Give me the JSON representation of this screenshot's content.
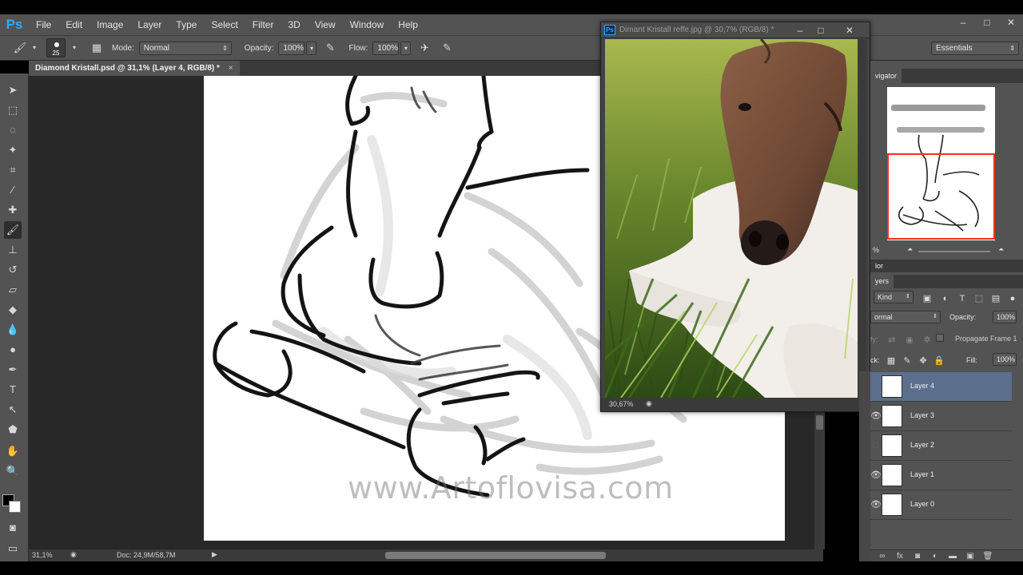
{
  "app": {
    "logo": "Ps",
    "accent": "#31a8ff"
  },
  "menu": [
    "File",
    "Edit",
    "Image",
    "Layer",
    "Type",
    "Select",
    "Filter",
    "3D",
    "View",
    "Window",
    "Help"
  ],
  "window_controls": [
    "–",
    "□",
    "✕"
  ],
  "options_bar": {
    "brush_size": "25",
    "mode_label": "Mode:",
    "mode_value": "Normal",
    "opacity_label": "Opacity:",
    "opacity_value": "100%",
    "flow_label": "Flow:",
    "flow_value": "100%",
    "workspace": "Essentials"
  },
  "document_tab": {
    "title": "Diamond Kristall.psd @ 31,1% (Layer 4, RGB/8) *",
    "close": "×"
  },
  "reference_window": {
    "title": "Dimant Kristall reffe.jpg @ 30,7% (RGB/8) *",
    "zoom": "30,67%",
    "controls": [
      "–",
      "□",
      "✕"
    ]
  },
  "canvas": {
    "watermark": "www.Artoflovisa.com"
  },
  "status_bar": {
    "zoom": "31,1%",
    "doc": "Doc: 24,9M/58,7M"
  },
  "navigator": {
    "tab": "vigator",
    "zoom": "%"
  },
  "color_panel": {
    "tab": "lor"
  },
  "layers_panel": {
    "tab": "yers",
    "filter_kind": "Kind",
    "blend_mode": "ormal",
    "opacity_label": "Opacity:",
    "opacity_value": "100%",
    "lock_label": "ck:",
    "propagate_label": "Propagate Frame 1",
    "fill_label": "Fill:",
    "fill_value": "100%",
    "layers": [
      {
        "name": "Layer 4",
        "visible": true,
        "selected": true
      },
      {
        "name": "Layer 3",
        "visible": true,
        "selected": false
      },
      {
        "name": "Layer 2",
        "visible": false,
        "selected": false
      },
      {
        "name": "Layer 1",
        "visible": true,
        "selected": false
      },
      {
        "name": "Layer 0",
        "visible": true,
        "selected": false
      }
    ]
  },
  "tools": [
    "move",
    "marquee",
    "lasso",
    "quick-select",
    "crop",
    "eyedropper",
    "healing",
    "brush",
    "stamp",
    "history-brush",
    "eraser",
    "bucket",
    "blur",
    "dodge",
    "pen",
    "type",
    "path-select",
    "shape",
    "hand",
    "zoom"
  ]
}
